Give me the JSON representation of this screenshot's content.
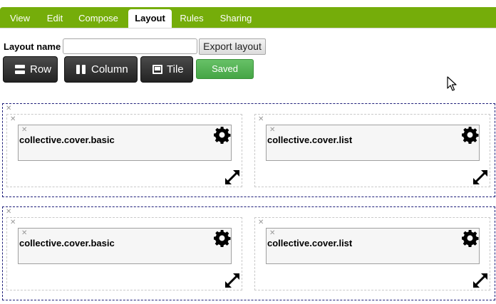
{
  "tabs": [
    {
      "label": "View"
    },
    {
      "label": "Edit"
    },
    {
      "label": "Compose"
    },
    {
      "label": "Layout"
    },
    {
      "label": "Rules"
    },
    {
      "label": "Sharing"
    }
  ],
  "active_tab": "Layout",
  "toolbar": {
    "layout_name_label": "Layout name",
    "layout_name_value": "",
    "export_label": "Export layout",
    "row_label": "Row",
    "column_label": "Column",
    "tile_label": "Tile",
    "saved_label": "Saved"
  },
  "icons": {
    "remove": "close-icon",
    "settings": "gear-icon",
    "resize": "resize-arrows-icon"
  },
  "colors": {
    "tab_bar": "#75ad0a",
    "saved_button": "#4fb04f",
    "row_border": "#1f1f7a",
    "dark_button": "#2f2f2f"
  },
  "layout": {
    "rows": [
      {
        "columns": [
          {
            "tile_title": "collective.cover.basic"
          },
          {
            "tile_title": "collective.cover.list"
          }
        ]
      },
      {
        "columns": [
          {
            "tile_title": "collective.cover.basic"
          },
          {
            "tile_title": "collective.cover.list"
          }
        ]
      }
    ]
  }
}
